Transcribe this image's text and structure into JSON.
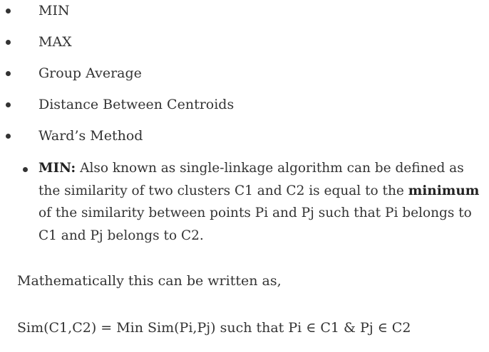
{
  "list": {
    "items": [
      "MIN",
      "MAX",
      "Group Average",
      "Distance Between Centroids",
      "Ward’s Method"
    ],
    "min_detail": {
      "term": "MIN:",
      "text_before": " Also known as single-linkage algorithm can be defined as the similarity of two clusters C1 and C2 is equal to the ",
      "emphasis": "minimum",
      "text_after": " of the similarity between points Pi and Pj such that Pi belongs to C1 and Pj belongs to C2."
    }
  },
  "paragraphs": {
    "intro": "Mathematically this can be written as,",
    "formula": "Sim(C1,C2) = Min Sim(Pi,Pj) such that Pi ∈ C1 & Pj ∈ C2"
  }
}
